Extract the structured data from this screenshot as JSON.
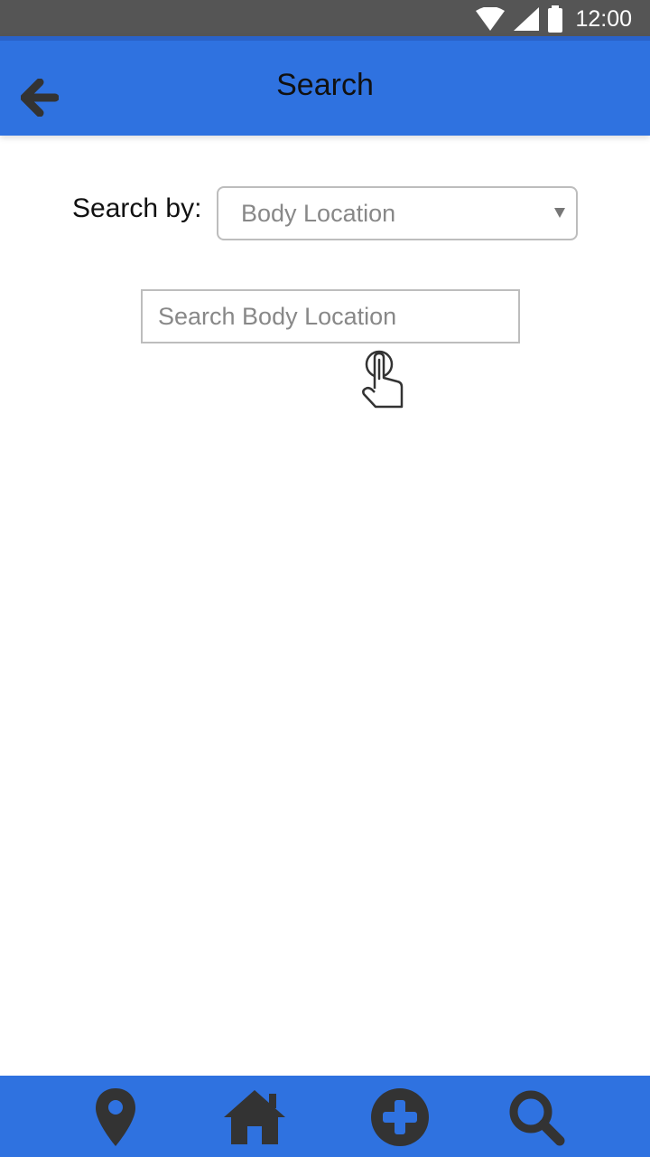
{
  "status_bar": {
    "time": "12:00",
    "icons": [
      "wifi-icon",
      "cell-signal-icon",
      "battery-icon"
    ]
  },
  "app_bar": {
    "title": "Search",
    "back_icon": "arrow-left-icon"
  },
  "search_form": {
    "search_by_label": "Search by:",
    "search_by_selected": "Body Location",
    "search_input_placeholder": "Search Body Location",
    "search_input_value": ""
  },
  "bottom_nav": {
    "items": [
      {
        "icon": "map-pin-icon"
      },
      {
        "icon": "home-icon"
      },
      {
        "icon": "plus-circle-icon"
      },
      {
        "icon": "search-icon"
      }
    ]
  },
  "colors": {
    "status_bar": "#555555",
    "primary": "#2f72e0",
    "icon_dark": "#333333",
    "border": "#bdbdbd",
    "placeholder": "#888888"
  }
}
